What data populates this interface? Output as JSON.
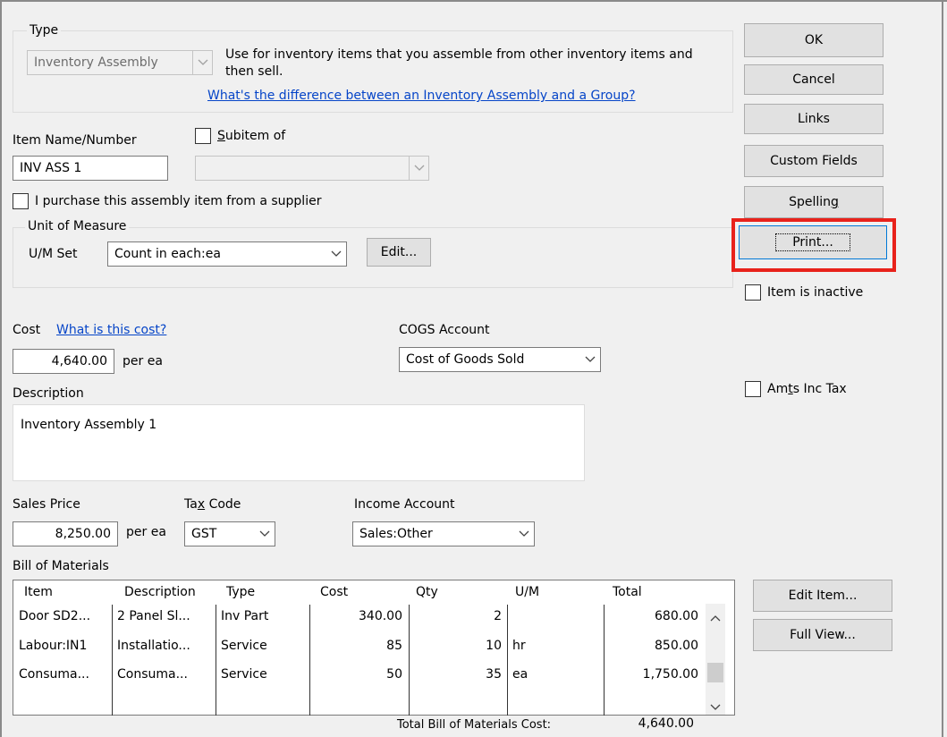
{
  "type_section": {
    "label": "Type",
    "selected": "Inventory Assembly",
    "description": "Use for inventory items that you assemble from other inventory items and then sell.",
    "help_link": "What's the difference between an Inventory Assembly and a Group?"
  },
  "item": {
    "name_label": "Item Name/Number",
    "name_value": "INV ASS 1",
    "subitem_label": "Subitem of",
    "subitem_value": "",
    "purchase_label": "I purchase this assembly item from a supplier"
  },
  "uom": {
    "section_label": "Unit of Measure",
    "set_label": "U/M Set",
    "set_value": "Count in each:ea",
    "edit_button": "Edit..."
  },
  "cost": {
    "label": "Cost",
    "help_link": "What is this cost?",
    "value": "4,640.00",
    "unit": "per ea",
    "cogs_label": "COGS Account",
    "cogs_value": "Cost of Goods Sold"
  },
  "description": {
    "label": "Description",
    "value": "Inventory Assembly 1"
  },
  "sales": {
    "price_label": "Sales Price",
    "price_value": "8,250.00",
    "unit": "per ea",
    "tax_label": "Tax Code",
    "tax_value": "GST",
    "income_label": "Income Account",
    "income_value": "Sales:Other"
  },
  "bom": {
    "label": "Bill of Materials",
    "columns": [
      "Item",
      "Description",
      "Type",
      "Cost",
      "Qty",
      "U/M",
      "Total"
    ],
    "rows": [
      {
        "item": "Door SD2...",
        "description": "2 Panel Sl...",
        "type": "Inv Part",
        "cost": "340.00",
        "qty": "2",
        "um": "",
        "total": "680.00"
      },
      {
        "item": "Labour:IN1",
        "description": "Installatio...",
        "type": "Service",
        "cost": "85",
        "qty": "10",
        "um": "hr",
        "total": "850.00"
      },
      {
        "item": "Consuma...",
        "description": "Consuma...",
        "type": "Service",
        "cost": "50",
        "qty": "35",
        "um": "ea",
        "total": "1,750.00"
      }
    ],
    "total_label": "Total Bill of Materials Cost:",
    "total_value": "4,640.00",
    "edit_item_button": "Edit Item...",
    "full_view_button": "Full View..."
  },
  "side_buttons": {
    "ok": "OK",
    "cancel": "Cancel",
    "links": "Links",
    "custom_fields": "Custom Fields",
    "spelling": "Spelling",
    "print": "Print...",
    "inactive_label": "Item is inactive",
    "amts_inc_tax_label": "Amts Inc Tax"
  },
  "colors": {
    "highlight": "#e8221b",
    "link": "#0645c8",
    "focus": "#0078d7"
  }
}
